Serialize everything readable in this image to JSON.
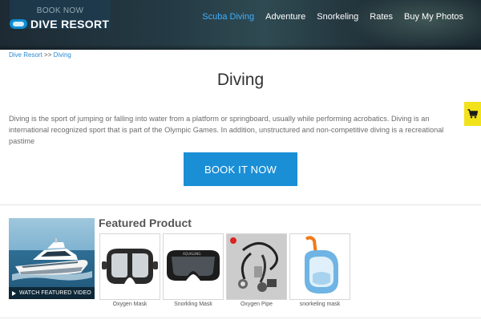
{
  "header": {
    "book_now_tab": "BOOK NOW",
    "logo_text": "DIVE RESORT",
    "nav": [
      {
        "label": "Scuba Diving",
        "active": true
      },
      {
        "label": "Adventure",
        "active": false
      },
      {
        "label": "Snorkeling",
        "active": false
      },
      {
        "label": "Rates",
        "active": false
      },
      {
        "label": "Buy My Photos",
        "active": false
      }
    ],
    "active_color": "#3fb0ff"
  },
  "breadcrumb": {
    "home": "Dive Resort",
    "separator": ">>",
    "current": "Diving"
  },
  "page": {
    "title": "Diving",
    "intro": "Diving is the sport of jumping or falling into water from a platform or springboard, usually while performing acrobatics. Diving is an international recognized sport that is part of the Olympic Games. In addition, unstructured and non-competitive diving is a recreational pastime",
    "book_button": "BOOK IT NOW",
    "button_color": "#1b8fd6"
  },
  "cart": {
    "icon": "cart-icon",
    "color": "#f2e21a"
  },
  "video": {
    "caption": "WATCH FEATURED VIDEO",
    "icon": "play-icon"
  },
  "featured": {
    "heading": "Featured Product",
    "products": [
      {
        "name": "Oxygen Mask",
        "icon": "dive-mask-icon"
      },
      {
        "name": "Snorkling Mask",
        "icon": "snorkel-mask-icon"
      },
      {
        "name": "Oxygen Pipe",
        "icon": "regulator-hose-icon"
      },
      {
        "name": "snorkeling mask",
        "icon": "full-face-snorkel-mask-icon"
      }
    ]
  }
}
